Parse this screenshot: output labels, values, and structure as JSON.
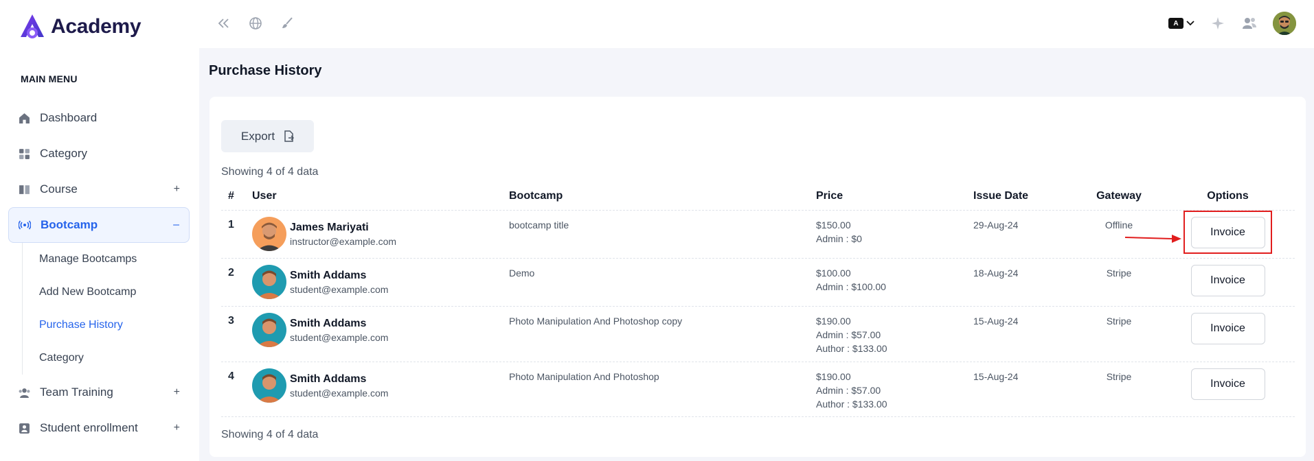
{
  "brand": {
    "name": "Academy"
  },
  "sidebar": {
    "heading": "MAIN MENU",
    "items": [
      {
        "label": "Dashboard",
        "icon": "home-icon"
      },
      {
        "label": "Category",
        "icon": "grid-icon"
      },
      {
        "label": "Course",
        "icon": "book-icon",
        "toggle": "+"
      },
      {
        "label": "Bootcamp",
        "icon": "broadcast-icon",
        "toggle": "–"
      },
      {
        "label": "Team Training",
        "icon": "team-icon",
        "toggle": "+"
      },
      {
        "label": "Student enrollment",
        "icon": "id-card-icon",
        "toggle": "+"
      }
    ],
    "bootcamp_sub": [
      "Manage Bootcamps",
      "Add New Bootcamp",
      "Purchase History",
      "Category"
    ]
  },
  "page": {
    "title": "Purchase History"
  },
  "toolbar": {
    "export_label": "Export"
  },
  "summary": {
    "top": "Showing 4 of 4 data",
    "bottom": "Showing 4 of 4 data"
  },
  "table": {
    "headers": [
      "#",
      "User",
      "Bootcamp",
      "Price",
      "Issue Date",
      "Gateway",
      "Options"
    ],
    "rows": [
      {
        "num": "1",
        "name": "James Mariyati",
        "email": "instructor@example.com",
        "bootcamp": "bootcamp title",
        "price": "$150.00",
        "admin": "Admin : $0",
        "author": "",
        "date": "29-Aug-24",
        "gateway": "Offline",
        "option": "Invoice"
      },
      {
        "num": "2",
        "name": "Smith Addams",
        "email": "student@example.com",
        "bootcamp": "Demo",
        "price": "$100.00",
        "admin": "Admin : $100.00",
        "author": "",
        "date": "18-Aug-24",
        "gateway": "Stripe",
        "option": "Invoice"
      },
      {
        "num": "3",
        "name": "Smith Addams",
        "email": "student@example.com",
        "bootcamp": "Photo Manipulation And Photoshop copy",
        "price": "$190.00",
        "admin": "Admin : $57.00",
        "author": "Author : $133.00",
        "date": "15-Aug-24",
        "gateway": "Stripe",
        "option": "Invoice"
      },
      {
        "num": "4",
        "name": "Smith Addams",
        "email": "student@example.com",
        "bootcamp": "Photo Manipulation And Photoshop",
        "price": "$190.00",
        "admin": "Admin : $57.00",
        "author": "Author : $133.00",
        "date": "15-Aug-24",
        "gateway": "Stripe",
        "option": "Invoice"
      }
    ]
  },
  "colors": {
    "accent": "#2563eb",
    "highlight": "#e11d1d",
    "brand": "#6d28d9"
  }
}
